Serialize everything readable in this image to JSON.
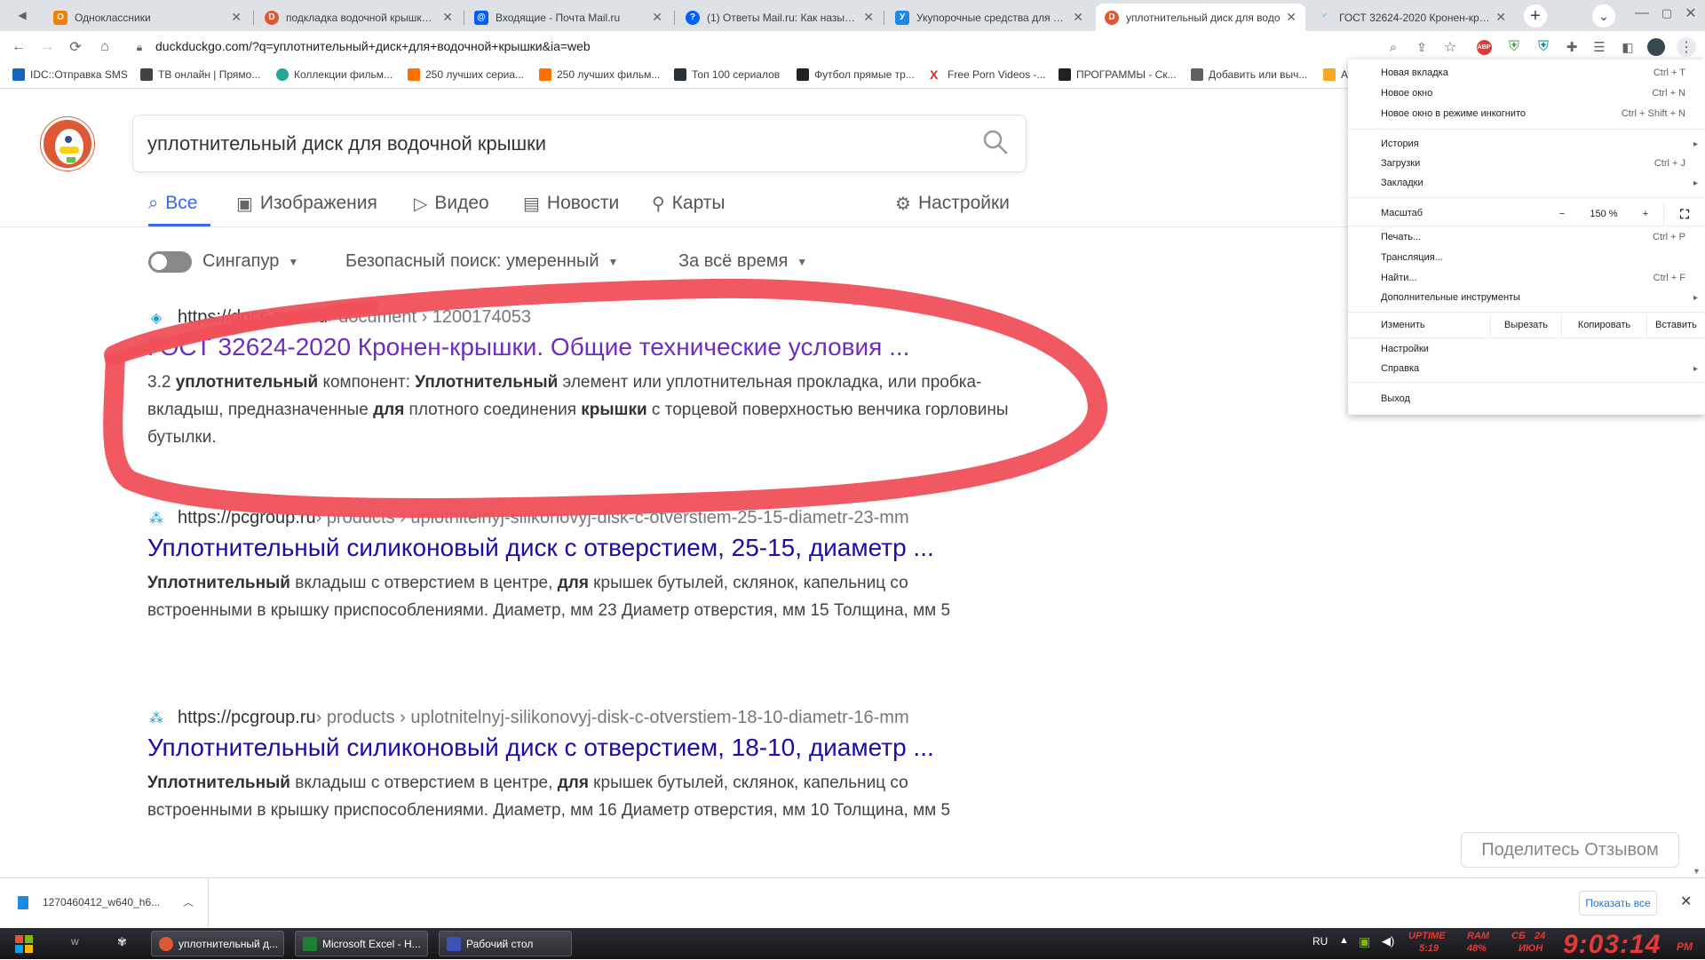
{
  "tabs": [
    {
      "label": "Одноклассники",
      "color": "#ee8208",
      "glyph": "О"
    },
    {
      "label": "подкладка водочной крышки ат",
      "color": "#de5833",
      "glyph": "D"
    },
    {
      "label": "Входящие - Почта Mail.ru",
      "color": "#005ff9",
      "glyph": "@"
    },
    {
      "label": "(1) Ответы Mail.ru: Как называе",
      "color": "#005ff9",
      "glyph": "?"
    },
    {
      "label": "Укупорочные средства для вод",
      "color": "#1e88e5",
      "glyph": "У"
    },
    {
      "label": "уплотнительный диск для водо",
      "color": "#de5833",
      "glyph": "D"
    },
    {
      "label": "ГОСТ 32624-2020 Кронен-крыш",
      "color": "#1a9ad9",
      "glyph": "Г"
    }
  ],
  "address": {
    "url": "duckduckgo.com/?q=уплотнительный+диск+для+водочной+крышки&ia=web"
  },
  "bookmarks": [
    {
      "label": "IDC::Отправка SMS",
      "color": "#1565c0"
    },
    {
      "label": "ТВ онлайн | Прямо...",
      "color": "#424242"
    },
    {
      "label": "Коллекции фильм...",
      "color": "#26a69a"
    },
    {
      "label": "250 лучших сериа...",
      "color": "#ff6f00"
    },
    {
      "label": "250 лучших фильм...",
      "color": "#ff6f00"
    },
    {
      "label": "Топ 100 сериалов",
      "color": "#263238"
    },
    {
      "label": "Футбол прямые тр...",
      "color": "#212121"
    },
    {
      "label": "Free Porn Videos -...",
      "color": "#d32f2f"
    },
    {
      "label": "ПРОГРАММЫ - Ск...",
      "color": "#212121"
    },
    {
      "label": "Добавить или выч...",
      "color": "#616161"
    },
    {
      "label": "A",
      "color": "#f9a825"
    }
  ],
  "search": {
    "query": "уплотнительный диск для водочной крышки"
  },
  "nav": {
    "all": "Все",
    "images": "Изображения",
    "video": "Видео",
    "news": "Новости",
    "maps": "Карты",
    "settings": "Настройки"
  },
  "filters": {
    "region": "Сингапур",
    "safe": "Безопасный поиск: умеренный",
    "time": "За всё время"
  },
  "results": [
    {
      "domain": "https://docs.cntd.ru",
      "path": " › document › 1200174053",
      "title": "ГОСТ 32624-2020 Кронен-крышки. Общие технические условия ...",
      "snippet": [
        "3.2 ",
        "уплотнительный",
        " компонент: ",
        "Уплотнительный",
        " элемент или уплотнительная прокладка, или пробка-вкладыш, предназначенные ",
        "для",
        " плотного соединения ",
        "крышки",
        " с торцевой поверхностью венчика горловины бутылки."
      ]
    },
    {
      "domain": "https://pcgroup.ru",
      "path": " › products › uplotnitelnyj-silikonovyj-disk-c-otverstiem-25-15-diametr-23-mm",
      "title": "Уплотнительный силиконовый диск с отверстием, 25-15, диаметр ...",
      "snippet": [
        "",
        "Уплотнительный",
        " вкладыш с отверстием в центре, ",
        "для",
        " крышек бутылей, склянок, капельниц со встроенными в крышку приспособлениями. Диаметр, мм 23 Диаметр отверстия, мм 15 Толщина, мм 5",
        "",
        ""
      ]
    },
    {
      "domain": "https://pcgroup.ru",
      "path": " › products › uplotnitelnyj-silikonovyj-disk-c-otverstiem-18-10-diametr-16-mm",
      "title": "Уплотнительный силиконовый диск с отверстием, 18-10, диаметр ...",
      "snippet": [
        "",
        "Уплотнительный",
        " вкладыш с отверстием в центре, ",
        "для",
        " крышек бутылей, склянок, капельниц со встроенными в крышку приспособлениями. Диаметр, мм 16 Диаметр отверстия, мм 10 Толщина, мм 5",
        "",
        ""
      ]
    }
  ],
  "feedback": "Поделитесь Отзывом",
  "menu": {
    "new_tab": "Новая вкладка",
    "new_tab_sc": "Ctrl + T",
    "new_window": "Новое окно",
    "new_window_sc": "Ctrl + N",
    "incognito": "Новое окно в режиме инкогнито",
    "incognito_sc": "Ctrl + Shift + N",
    "history": "История",
    "downloads": "Загрузки",
    "downloads_sc": "Ctrl + J",
    "bookmarks": "Закладки",
    "zoom": "Масштаб",
    "zoom_minus": "−",
    "zoom_value": "150 %",
    "zoom_plus": "+",
    "print": "Печать...",
    "print_sc": "Ctrl + P",
    "cast": "Трансляция...",
    "find": "Найти...",
    "find_sc": "Ctrl + F",
    "more_tools": "Дополнительные инструменты",
    "edit": "Изменить",
    "cut": "Вырезать",
    "copy": "Копировать",
    "paste": "Вставить",
    "settings": "Настройки",
    "help": "Справка",
    "exit": "Выход"
  },
  "download": {
    "filename": "1270460412_w640_h6...",
    "show_all": "Показать все"
  },
  "taskbar": {
    "tasks": [
      {
        "label": "уплотнительный д...",
        "color": "#de5833"
      },
      {
        "label": "Microsoft Excel - Н...",
        "color": "#1e7e34"
      },
      {
        "label": "Рабочий стол",
        "color": "#3f51b5"
      }
    ],
    "lang": "RU",
    "uptime_label": "UPTIME",
    "uptime_value": "5:19",
    "ram_label": "RAM",
    "ram_value": "48%",
    "day": "СБ",
    "date": "24",
    "month": "ИЮН",
    "clock": "9:03:14",
    "ampm": "PM"
  },
  "colors": {
    "annotation": "#f0505a",
    "accent": "#3969ef"
  }
}
